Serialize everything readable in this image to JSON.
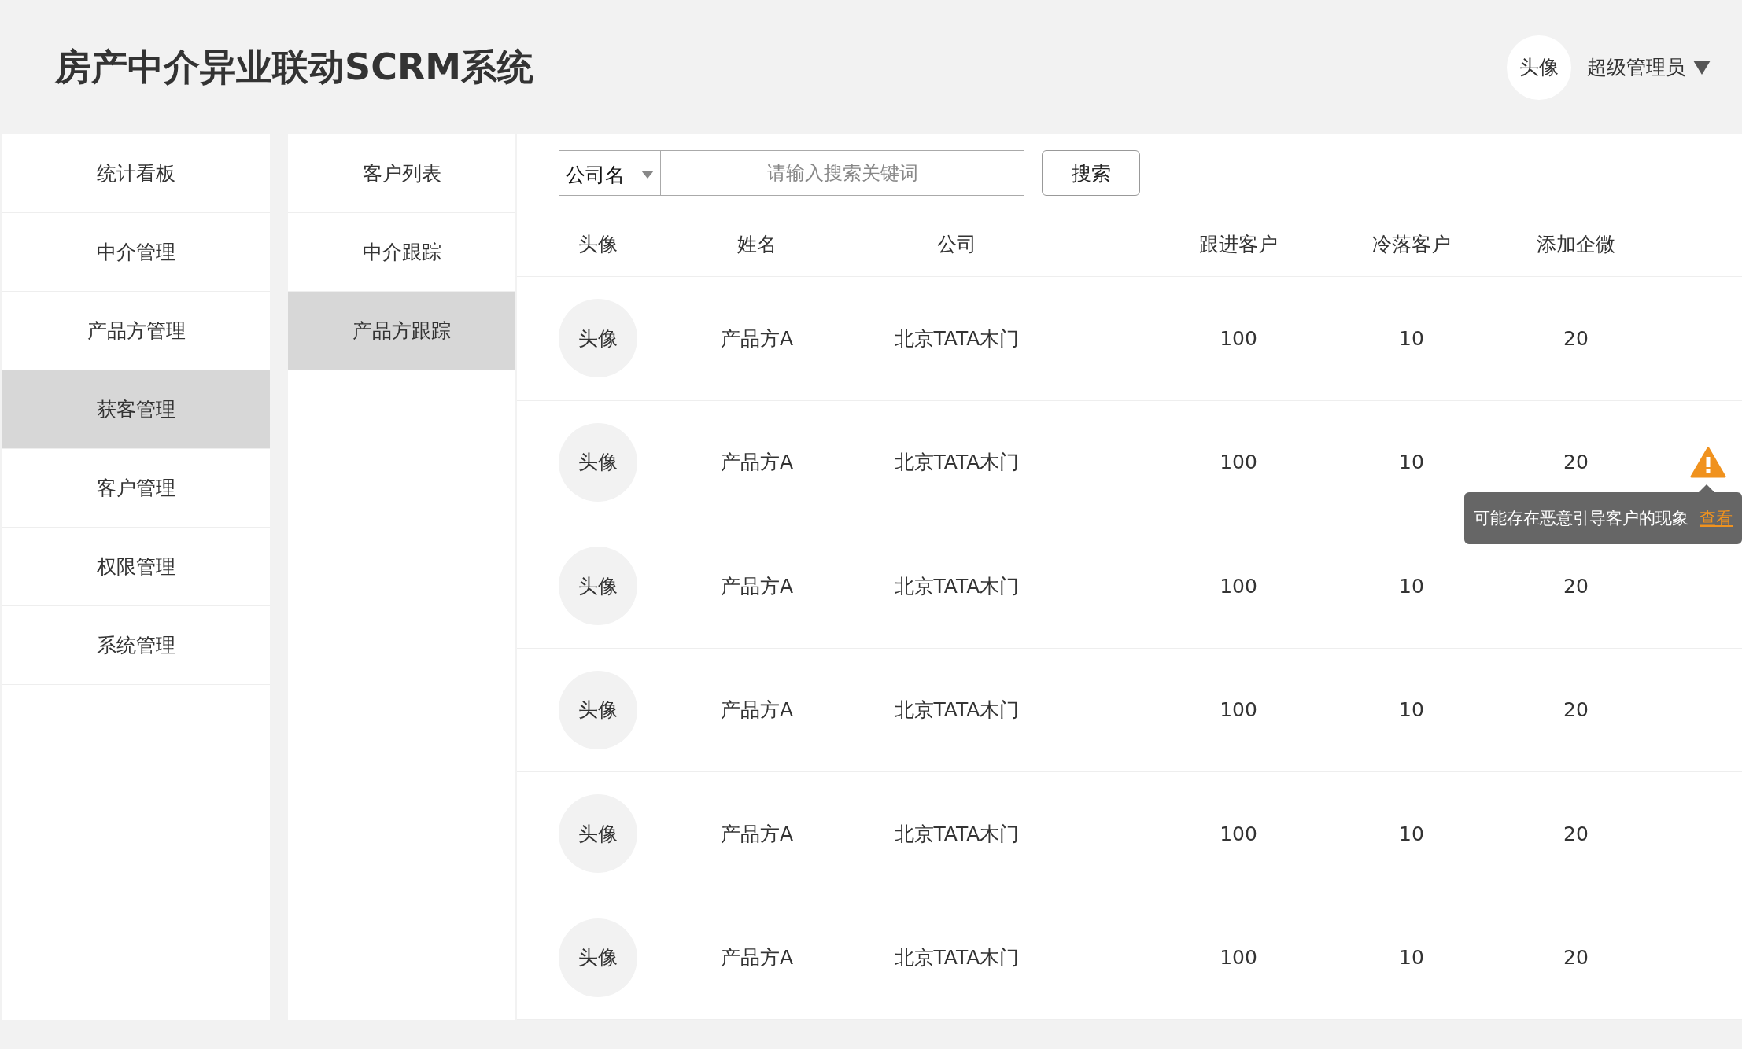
{
  "header": {
    "title": "房产中介异业联动SCRM系统",
    "avatar": "头像",
    "user": "超级管理员"
  },
  "nav": [
    {
      "label": "统计看板",
      "selected": false
    },
    {
      "label": "中介管理",
      "selected": false
    },
    {
      "label": "产品方管理",
      "selected": false
    },
    {
      "label": "获客管理",
      "selected": true
    },
    {
      "label": "客户管理",
      "selected": false
    },
    {
      "label": "权限管理",
      "selected": false
    },
    {
      "label": "系统管理",
      "selected": false
    }
  ],
  "subnav": [
    {
      "label": "客户列表",
      "selected": false
    },
    {
      "label": "中介跟踪",
      "selected": false
    },
    {
      "label": "产品方跟踪",
      "selected": true
    }
  ],
  "search": {
    "filter": "公司名",
    "placeholder": "请输入搜索关键词",
    "button": "搜索"
  },
  "table": {
    "columns": [
      "头像",
      "姓名",
      "公司",
      "跟进客户",
      "冷落客户",
      "添加企微"
    ],
    "rows": [
      {
        "avatar": "头像",
        "name": "产品方A",
        "company": "北京TATA木门",
        "following": "100",
        "cold": "10",
        "wechat": "20"
      },
      {
        "avatar": "头像",
        "name": "产品方A",
        "company": "北京TATA木门",
        "following": "100",
        "cold": "10",
        "wechat": "20",
        "warning": {
          "text": "可能存在恶意引导客户的现象",
          "link": "查看"
        }
      },
      {
        "avatar": "头像",
        "name": "产品方A",
        "company": "北京TATA木门",
        "following": "100",
        "cold": "10",
        "wechat": "20"
      },
      {
        "avatar": "头像",
        "name": "产品方A",
        "company": "北京TATA木门",
        "following": "100",
        "cold": "10",
        "wechat": "20"
      },
      {
        "avatar": "头像",
        "name": "产品方A",
        "company": "北京TATA木门",
        "following": "100",
        "cold": "10",
        "wechat": "20"
      },
      {
        "avatar": "头像",
        "name": "产品方A",
        "company": "北京TATA木门",
        "following": "100",
        "cold": "10",
        "wechat": "20"
      }
    ]
  }
}
